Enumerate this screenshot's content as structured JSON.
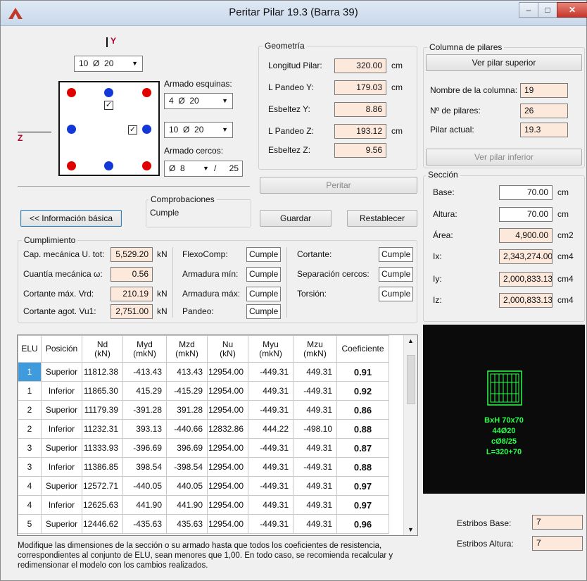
{
  "window": {
    "title": "Peritar Pilar 19.3 (Barra 39)",
    "min_glyph": "–",
    "max_glyph": "□",
    "close_glyph": "✕",
    "icon": "app-logo-icon"
  },
  "section_diagram": {
    "axis_y": "Y",
    "axis_z": "Z",
    "top_combo": {
      "count": "10",
      "phi": "Ø",
      "dia": "20"
    },
    "corner_label": "Armado esquinas:",
    "corner_combo": {
      "count": "4",
      "phi": "Ø",
      "dia": "20"
    },
    "side_combo": {
      "count": "10",
      "phi": "Ø",
      "dia": "20"
    },
    "cercos_label": "Armado cercos:",
    "cercos_combo": {
      "phi": "Ø",
      "dia": "8",
      "sep_glyph": "/",
      "spacing": "25"
    }
  },
  "geometria": {
    "title": "Geometría",
    "rows": [
      {
        "label": "Longitud Pilar:",
        "value": "320.00",
        "unit": "cm"
      },
      {
        "label": "L Pandeo Y:",
        "value": "179.03",
        "unit": "cm"
      },
      {
        "label": "Esbeltez Y:",
        "value": "8.86",
        "unit": ""
      },
      {
        "label": "L Pandeo Z:",
        "value": "193.12",
        "unit": "cm"
      },
      {
        "label": "Esbeltez Z:",
        "value": "9.56",
        "unit": ""
      }
    ],
    "peritar_button": "Peritar"
  },
  "columna": {
    "title": "Columna de pilares",
    "ver_superior": "Ver pilar superior",
    "nombre_label": "Nombre de la columna:",
    "nombre_value": "19",
    "npilares_label": "Nº de pilares:",
    "npilares_value": "26",
    "actual_label": "Pilar actual:",
    "actual_value": "19.3",
    "ver_inferior": "Ver pilar inferior"
  },
  "seccion": {
    "title": "Sección",
    "rows": [
      {
        "label": "Base:",
        "value": "70.00",
        "unit": "cm"
      },
      {
        "label": "Altura:",
        "value": "70.00",
        "unit": "cm"
      },
      {
        "label": "Área:",
        "value": "4,900.00",
        "unit": "cm2"
      },
      {
        "label": "Ix:",
        "value": "2,343,274.00",
        "unit": "cm4"
      },
      {
        "label": "Iy:",
        "value": "2,000,833.13",
        "unit": "cm4"
      },
      {
        "label": "Iz:",
        "value": "2,000,833.13",
        "unit": "cm4"
      }
    ]
  },
  "comprobaciones": {
    "title": "Comprobaciones",
    "value": "Cumple"
  },
  "buttons": {
    "info_basica": "<< Información básica",
    "guardar": "Guardar",
    "restablecer": "Restablecer"
  },
  "cumplimiento": {
    "title": "Cumplimiento",
    "col1": [
      {
        "label": "Cap. mecánica U. tot:",
        "value": "5,529.20",
        "unit": "kN"
      },
      {
        "label": "Cuantía mecánica ω:",
        "value": "0.56",
        "unit": ""
      },
      {
        "label": "Cortante máx. Vrd:",
        "value": "210.19",
        "unit": "kN"
      },
      {
        "label": "Cortante agot. Vu1:",
        "value": "2,751.00",
        "unit": "kN"
      }
    ],
    "col2": [
      {
        "label": "FlexoComp:",
        "value": "Cumple"
      },
      {
        "label": "Armadura mín:",
        "value": "Cumple"
      },
      {
        "label": "Armadura máx:",
        "value": "Cumple"
      },
      {
        "label": "Pandeo:",
        "value": "Cumple"
      }
    ],
    "col3": [
      {
        "label": "Cortante:",
        "value": "Cumple"
      },
      {
        "label": "Separación cercos:",
        "value": "Cumple"
      },
      {
        "label": "Torsión:",
        "value": "Cumple"
      }
    ]
  },
  "table": {
    "headers": [
      [
        "ELU"
      ],
      [
        "Posición"
      ],
      [
        "Nd",
        "(kN)"
      ],
      [
        "Myd",
        "(mkN)"
      ],
      [
        "Mzd",
        "(mkN)"
      ],
      [
        "Nu",
        "(kN)"
      ],
      [
        "Myu",
        "(mkN)"
      ],
      [
        "Mzu",
        "(mkN)"
      ],
      [
        "Coeficiente"
      ]
    ],
    "rows": [
      [
        "1",
        "Superior",
        "11812.38",
        "-413.43",
        "413.43",
        "12954.00",
        "-449.31",
        "449.31",
        "0.91"
      ],
      [
        "1",
        "Inferior",
        "11865.30",
        "415.29",
        "-415.29",
        "12954.00",
        "449.31",
        "-449.31",
        "0.92"
      ],
      [
        "2",
        "Superior",
        "11179.39",
        "-391.28",
        "391.28",
        "12954.00",
        "-449.31",
        "449.31",
        "0.86"
      ],
      [
        "2",
        "Inferior",
        "11232.31",
        "393.13",
        "-440.66",
        "12832.86",
        "444.22",
        "-498.10",
        "0.88"
      ],
      [
        "3",
        "Superior",
        "11333.93",
        "-396.69",
        "396.69",
        "12954.00",
        "-449.31",
        "449.31",
        "0.87"
      ],
      [
        "3",
        "Inferior",
        "11386.85",
        "398.54",
        "-398.54",
        "12954.00",
        "449.31",
        "-449.31",
        "0.88"
      ],
      [
        "4",
        "Superior",
        "12572.71",
        "-440.05",
        "440.05",
        "12954.00",
        "-449.31",
        "449.31",
        "0.97"
      ],
      [
        "4",
        "Inferior",
        "12625.63",
        "441.90",
        "441.90",
        "12954.00",
        "449.31",
        "449.31",
        "0.97"
      ],
      [
        "5",
        "Superior",
        "12446.62",
        "-435.63",
        "435.63",
        "12954.00",
        "-449.31",
        "449.31",
        "0.96"
      ]
    ]
  },
  "preview": {
    "lines": [
      "BxH 70x70",
      "44Ø20",
      "cØ8/25",
      "L=320+70"
    ],
    "color": "#28ff4a"
  },
  "estribos": {
    "base_label": "Estribos Base:",
    "base_value": "7",
    "altura_label": "Estribos Altura:",
    "altura_value": "7"
  },
  "note": "Modifique las dimensiones de la sección o su armado hasta que todos los coeficientes de resistencia, correspondientes al conjunto de ELU, sean menores que 1,00. En todo caso, se recomienda recalcular y redimensionar el modelo con los cambios realizados."
}
